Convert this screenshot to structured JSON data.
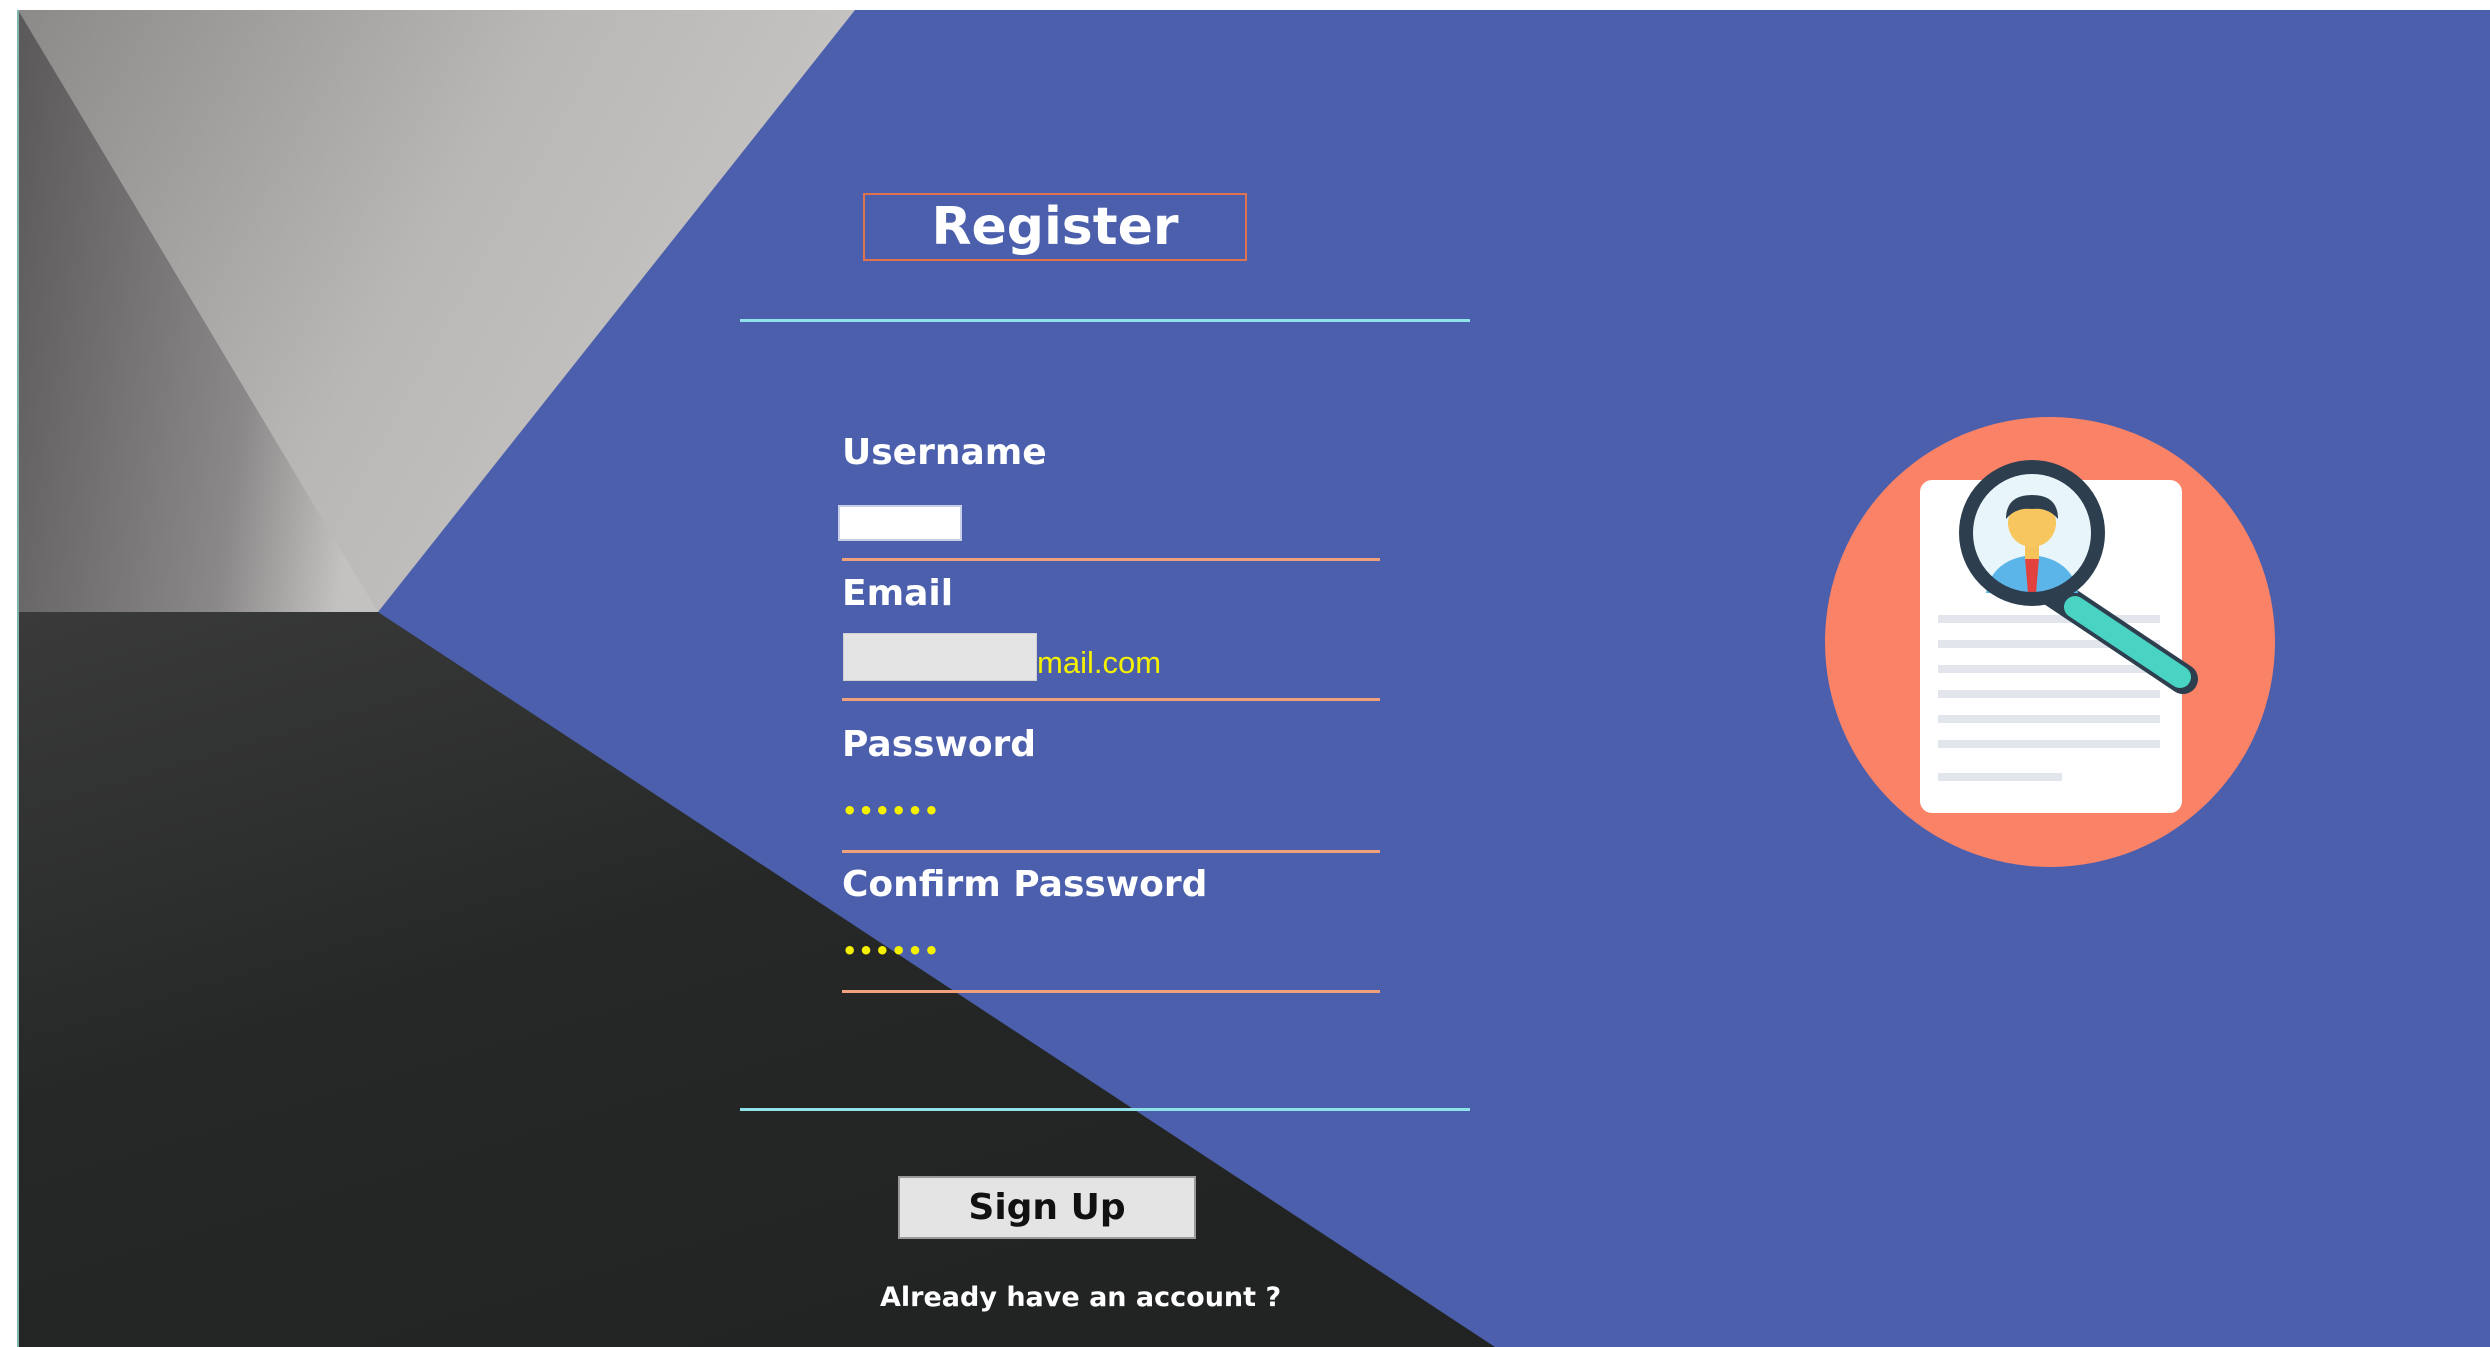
{
  "form": {
    "title": "Register",
    "username_label": "Username",
    "username_value": "",
    "email_label": "Email",
    "email_value": "",
    "email_suffix": "mail.com",
    "password_label": "Password",
    "password_masked": "••••••",
    "confirm_label": "Confirm Password",
    "confirm_masked": "••••••",
    "signup_label": "Sign Up",
    "login_link": "Already have an account ?"
  },
  "icons": {
    "illustration": "resume-search-icon"
  },
  "colors": {
    "background_blue": "#4b5fac",
    "field_underline": "#f0a07a",
    "divider": "#8fe3e8",
    "masked_text": "#f4f000",
    "title_border": "#e0734f",
    "illustration_circle": "#fa8266"
  }
}
